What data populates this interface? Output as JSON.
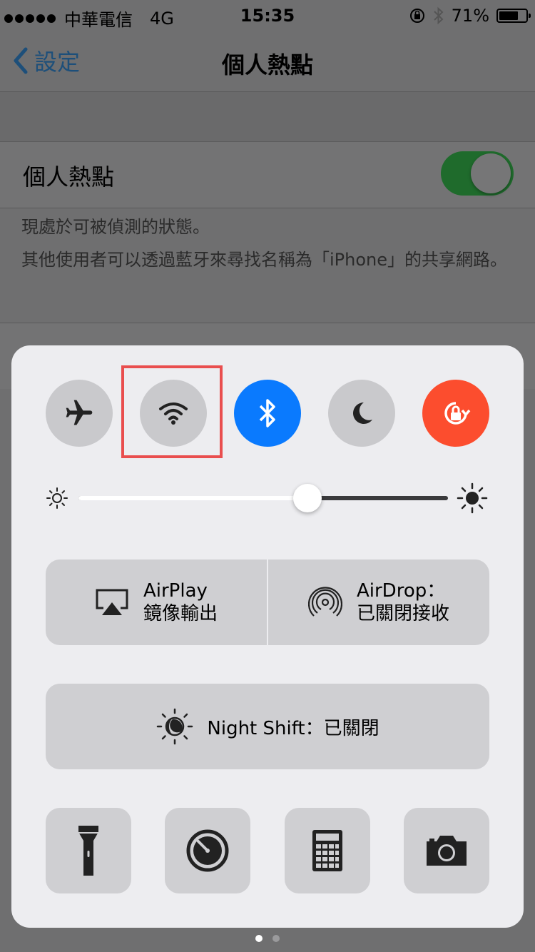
{
  "status_bar": {
    "carrier": "中華電信",
    "network": "4G",
    "time": "15:35",
    "battery": "71%",
    "battery_level": 0.71
  },
  "nav": {
    "back_label": "設定",
    "title": "個人熱點"
  },
  "settings": {
    "hotspot_label": "個人熱點",
    "hotspot_on": true,
    "footer_line1": "現處於可被偵測的狀態。",
    "footer_line2": "其他使用者可以透過藍牙來尋找名稱為「iPhone」的共享網路。"
  },
  "control_center": {
    "toggles": [
      {
        "name": "airplane-mode",
        "icon": "airplane-icon",
        "state": "off"
      },
      {
        "name": "wifi",
        "icon": "wifi-icon",
        "state": "off",
        "highlighted": true
      },
      {
        "name": "bluetooth",
        "icon": "bluetooth-icon",
        "state": "on"
      },
      {
        "name": "do-not-disturb",
        "icon": "moon-icon",
        "state": "off"
      },
      {
        "name": "rotation-lock",
        "icon": "rotation-lock-icon",
        "state": "on"
      }
    ],
    "brightness": 0.62,
    "airplay": {
      "line1": "AirPlay",
      "line2": "鏡像輸出"
    },
    "airdrop": {
      "line1": "AirDrop：",
      "line2": "已關閉接收"
    },
    "night_shift": {
      "label": "Night Shift：已關閉"
    },
    "shortcuts": [
      "flashlight-icon",
      "timer-icon",
      "calculator-icon",
      "camera-icon"
    ],
    "colors": {
      "bluetooth": "#0a7afe",
      "rotation_lock": "#fc4d2e",
      "highlight": "#e94e4e"
    }
  },
  "pages": {
    "count": 2,
    "current": 1
  }
}
